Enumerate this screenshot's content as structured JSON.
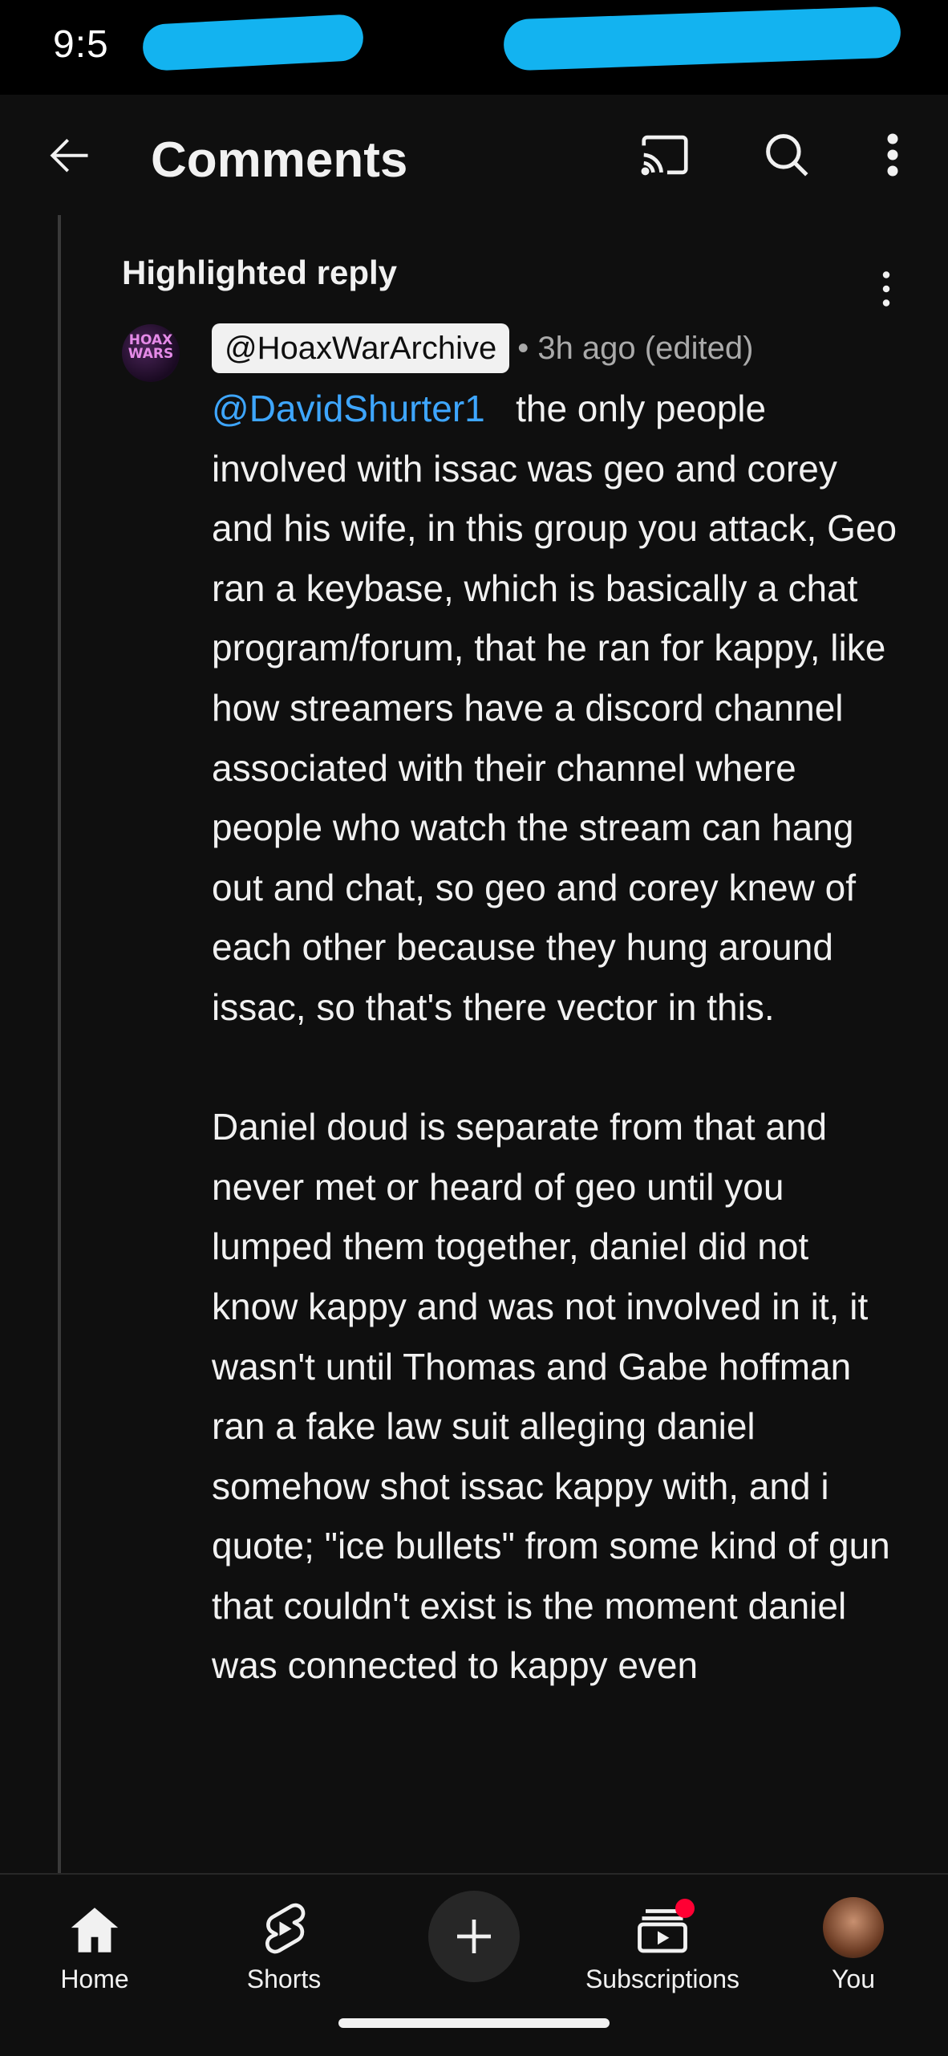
{
  "status_bar": {
    "time": "9:5"
  },
  "header": {
    "title": "Comments"
  },
  "comment": {
    "label": "Highlighted reply",
    "avatar_text": "HOAX WARS",
    "author": "@HoaxWarArchive",
    "meta": "• 3h ago (edited)",
    "mention": "@DavidShurter1",
    "text_after_mention": "   the only people involved with issac was geo and corey and his wife, in this group you attack, Geo ran a keybase, which is basically a chat program/forum, that he ran for kappy, like how streamers have a discord channel associated with their channel where people who watch the stream can hang out and chat, so geo and corey knew of each other because they hung around issac, so that's there vector in this.\n\nDaniel doud is separate from that and never met or heard of geo until you lumped them together, daniel did not know kappy and was not involved in it, it wasn't until Thomas and Gabe hoffman ran a fake law suit alleging daniel somehow shot issac kappy with, and i quote; \"ice bullets\" from some kind of gun that couldn't exist is the moment daniel was connected to kappy even"
  },
  "nav": {
    "home": "Home",
    "shorts": "Shorts",
    "subscriptions": "Subscriptions",
    "you": "You"
  },
  "colors": {
    "background": "#0f0f0f",
    "mention": "#3ea6ff",
    "notification_dot": "#ff0033"
  }
}
